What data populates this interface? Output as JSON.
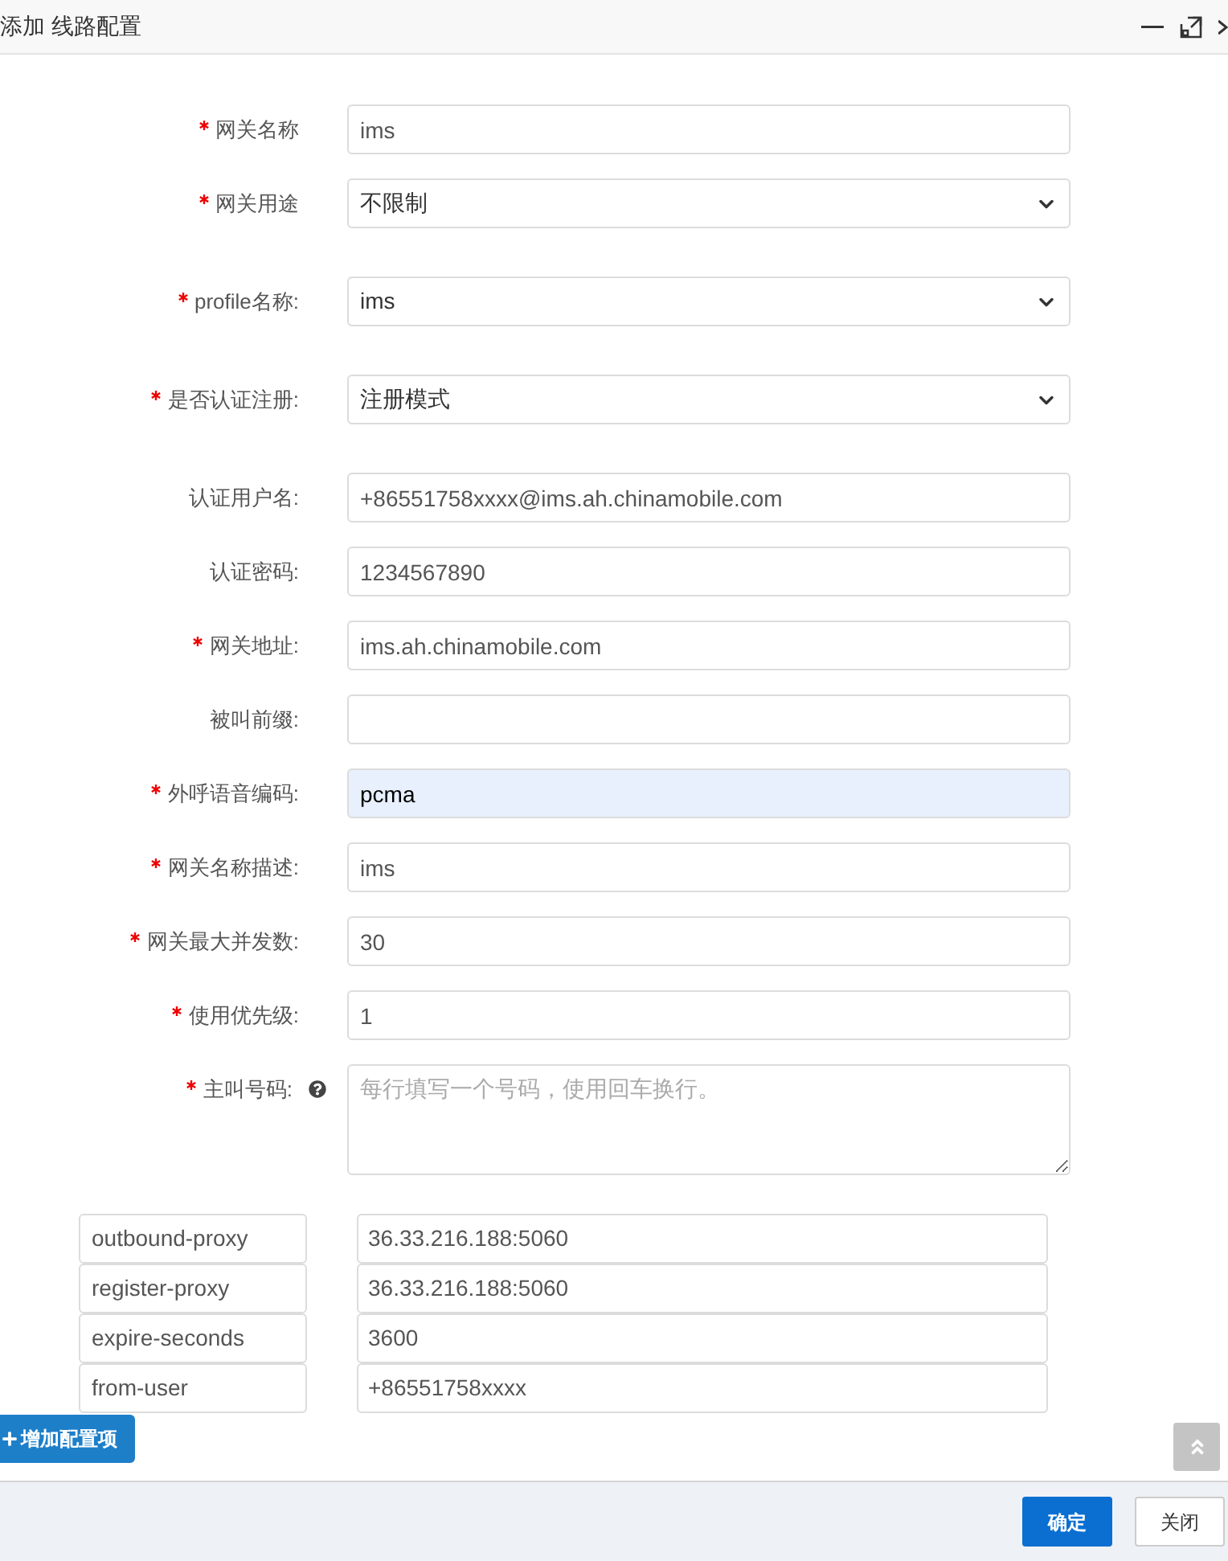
{
  "window": {
    "title": "添加 线路配置"
  },
  "fields": [
    {
      "label": "网关名称",
      "required": true,
      "kind": "input",
      "value": "ims"
    },
    {
      "label": "网关用途",
      "required": true,
      "kind": "select",
      "value": "不限制"
    },
    {
      "label": "profile名称:",
      "required": true,
      "kind": "select",
      "value": "ims"
    },
    {
      "label": "是否认证注册:",
      "required": true,
      "kind": "select",
      "value": "注册模式"
    },
    {
      "label": "认证用户名:",
      "required": false,
      "kind": "input",
      "value": "+86551758xxxx@ims.ah.chinamobile.com"
    },
    {
      "label": "认证密码:",
      "required": false,
      "kind": "input",
      "value": "1234567890"
    },
    {
      "label": "网关地址:",
      "required": true,
      "kind": "input",
      "value": "ims.ah.chinamobile.com"
    },
    {
      "label": "被叫前缀:",
      "required": false,
      "kind": "input"
    },
    {
      "label": "外呼语音编码:",
      "required": true,
      "kind": "input",
      "value": "pcma",
      "highlighted": true
    },
    {
      "label": "网关名称描述:",
      "required": true,
      "kind": "input",
      "value": "ims"
    },
    {
      "label": "网关最大并发数:",
      "required": true,
      "kind": "input",
      "value": "30"
    },
    {
      "label": "使用优先级:",
      "required": true,
      "kind": "input",
      "value": "1"
    },
    {
      "label": "主叫号码:",
      "required": true,
      "kind": "textarea",
      "placeholder": "每行填写一个号码，使用回车换行。",
      "help": true
    }
  ],
  "extra_params": [
    {
      "key": "outbound-proxy",
      "value": "36.33.216.188:5060"
    },
    {
      "key": "register-proxy",
      "value": "36.33.216.188:5060"
    },
    {
      "key": "expire-seconds",
      "value": "3600"
    },
    {
      "key": "from-user",
      "value": "+86551758xxxx"
    }
  ],
  "add_button": "增加配置项",
  "buttons": [
    {
      "label": "确定",
      "kind": "primary"
    },
    {
      "label": "关闭",
      "kind": "default"
    }
  ]
}
